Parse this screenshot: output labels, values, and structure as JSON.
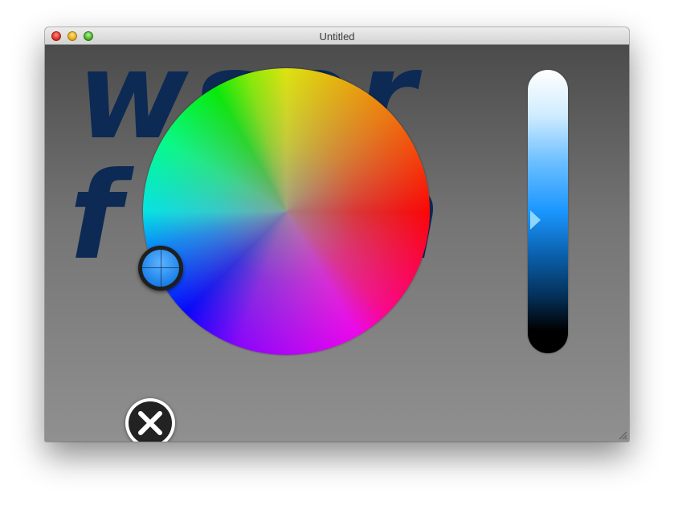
{
  "window": {
    "title": "Untitled",
    "traffic_lights": [
      "close",
      "minimize",
      "zoom"
    ]
  },
  "background_text": {
    "line1": "wser",
    "line2": "f   on",
    "color": "#0d2a55"
  },
  "color_picker": {
    "selected_color": "#1a7ee8",
    "brightness_slider": {
      "top_color": "#ffffff",
      "mid_color": "#1a96ff",
      "bottom_color": "#000000",
      "value": 0.53
    }
  },
  "close_button": {
    "icon": "close-x-icon"
  }
}
